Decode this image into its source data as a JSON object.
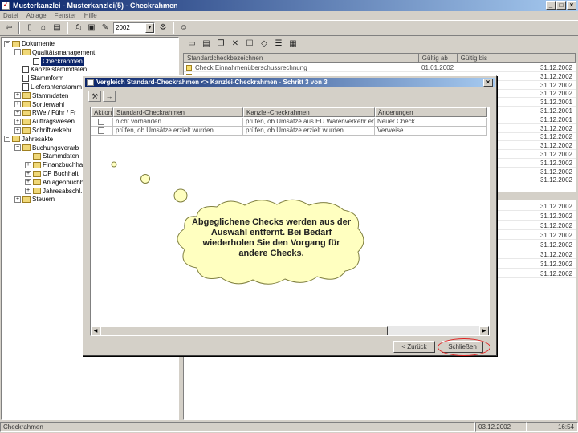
{
  "window": {
    "title": "Musterkanzlei - Musterkanzlei(5) - Checkrahmen",
    "buttons": [
      "_",
      "□",
      "×"
    ]
  },
  "menu": [
    "Datei",
    "Ablage",
    "Fenster",
    "Hilfe"
  ],
  "toolbar": {
    "year": "2002",
    "icons": [
      "back-icon",
      "new-doc-icon",
      "open-icon",
      "save-icon",
      "print-icon",
      "preview-icon",
      "edit-icon",
      "tools-icon",
      "person-icon"
    ]
  },
  "tree": [
    {
      "label": "Dokumente",
      "level": 0,
      "toggle": "−",
      "icon": "folder",
      "selected": false
    },
    {
      "label": "Qualitätsmanagement",
      "level": 1,
      "toggle": "−",
      "icon": "folder",
      "selected": false
    },
    {
      "label": "Checkrahmen",
      "level": 2,
      "toggle": "",
      "icon": "doc",
      "selected": true
    },
    {
      "label": "Kanzleistammdaten",
      "level": 1,
      "toggle": "",
      "icon": "doc",
      "selected": false
    },
    {
      "label": "Stammform",
      "level": 1,
      "toggle": "",
      "icon": "doc",
      "selected": false
    },
    {
      "label": "Lieferantenstamm",
      "level": 1,
      "toggle": "",
      "icon": "doc",
      "selected": false
    },
    {
      "label": "Stammdaten",
      "level": 1,
      "toggle": "+",
      "icon": "folder",
      "selected": false
    },
    {
      "label": "Sortierwahl",
      "level": 1,
      "toggle": "+",
      "icon": "folder",
      "selected": false
    },
    {
      "label": "RWe / Führ / Fr",
      "level": 1,
      "toggle": "+",
      "icon": "folder",
      "selected": false
    },
    {
      "label": "Auftragswesen",
      "level": 1,
      "toggle": "+",
      "icon": "folder",
      "selected": false
    },
    {
      "label": "Schriftverkehr",
      "level": 1,
      "toggle": "+",
      "icon": "folder",
      "selected": false
    },
    {
      "label": "Jahresakte",
      "level": 0,
      "toggle": "−",
      "icon": "folder",
      "selected": false
    },
    {
      "label": "Buchungsverarb",
      "level": 1,
      "toggle": "−",
      "icon": "folder",
      "selected": false
    },
    {
      "label": "Stammdaten",
      "level": 2,
      "toggle": "",
      "icon": "folder",
      "selected": false
    },
    {
      "label": "Finanzbuchha",
      "level": 2,
      "toggle": "+",
      "icon": "folder",
      "selected": false
    },
    {
      "label": "OP Buchhalt",
      "level": 2,
      "toggle": "+",
      "icon": "folder",
      "selected": false
    },
    {
      "label": "Anlagenbuchh",
      "level": 2,
      "toggle": "+",
      "icon": "folder",
      "selected": false
    },
    {
      "label": "Jahresabschl.",
      "level": 2,
      "toggle": "+",
      "icon": "folder",
      "selected": false
    },
    {
      "label": "Steuern",
      "level": 1,
      "toggle": "+",
      "icon": "folder",
      "selected": false
    }
  ],
  "grid": {
    "headers": [
      "Standardcheckbezeichnen",
      "Gültig ab",
      "Gültig bis"
    ],
    "first_row": {
      "name": "Check Einnahmenüberschussrechnung",
      "from": "01.01.2002"
    },
    "dates": [
      "31.12.2002",
      "31.12.2002",
      "31.12.2002",
      "31.12.2002",
      "31.12.2001",
      "31.12.2001",
      "31.12.2001",
      "31.12.2002",
      "31.12.2002",
      "31.12.2002",
      "31.12.2002",
      "31.12.2002",
      "31.12.2002",
      "31.12.2002"
    ],
    "lower_dates": [
      "31.12.2002",
      "31.12.2002",
      "31.12.2002",
      "31.12.2002",
      "31.12.2002",
      "31.12.2002",
      "31.12.2002",
      "31.12.2002"
    ]
  },
  "status": {
    "left": "Checkrahmen",
    "date": "03.12.2002",
    "time": "16:54"
  },
  "dialog": {
    "title": "Vergleich Standard-Checkrahmen <> Kanzlei-Checkrahmen - Schritt 3 von 3",
    "columns": [
      "Aktion",
      "Standard-Checkrahmen",
      "Kanzlei-Checkrahmen",
      "Änderungen"
    ],
    "rows": [
      {
        "standard": "nicht vorhanden",
        "kanzlei": "prüfen, ob Umsätze aus EU Warenverkehr erzi",
        "change": "Neuer Check"
      },
      {
        "standard": "prüfen, ob Umsätze erzielt wurden",
        "kanzlei": "prüfen, ob Umsätze erzielt wurden",
        "change": "Verweise"
      }
    ],
    "back_label": "< Zurück",
    "close_label": "Schließen"
  },
  "callout": {
    "text": "Abgeglichene Checks werden aus der Auswahl entfernt. Bei Bedarf wiederholen Sie den Vorgang für andere Checks."
  }
}
